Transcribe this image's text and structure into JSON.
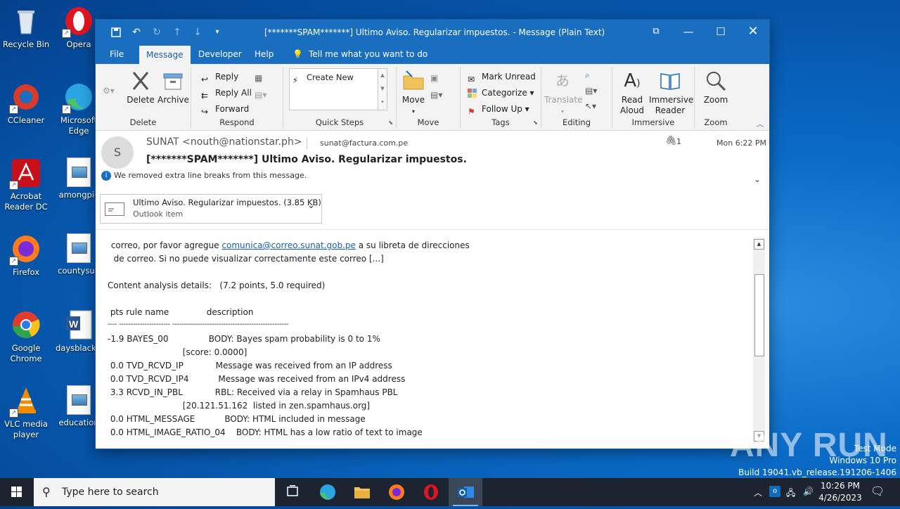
{
  "desktop": {
    "icons": [
      {
        "label": "Recycle Bin"
      },
      {
        "label": "Opera"
      },
      {
        "label": "CCleaner"
      },
      {
        "label": "Microsoft Edge"
      },
      {
        "label": "Acrobat Reader DC"
      },
      {
        "label": "amongpic"
      },
      {
        "label": "Firefox"
      },
      {
        "label": "countysub"
      },
      {
        "label": "Google Chrome"
      },
      {
        "label": "daysblack.r"
      },
      {
        "label": "VLC media player"
      },
      {
        "label": "education"
      }
    ]
  },
  "window": {
    "title": "[*******SPAM*******] Ultimo Aviso. Regularizar impuestos.  -  Message (Plain Text)",
    "menu": [
      "File",
      "Message",
      "Developer",
      "Help"
    ],
    "active_menu": "Message",
    "tell_me": "Tell me what you want to do"
  },
  "ribbon": {
    "delete_group": {
      "label": "Delete",
      "delete": "Delete",
      "archive": "Archive"
    },
    "respond_group": {
      "label": "Respond",
      "reply": "Reply",
      "reply_all": "Reply All",
      "forward": "Forward"
    },
    "quicksteps_group": {
      "label": "Quick Steps",
      "create_new": "Create New"
    },
    "move_group": {
      "label": "Move",
      "move": "Move"
    },
    "tags_group": {
      "label": "Tags",
      "mark_unread": "Mark Unread",
      "categorize": "Categorize",
      "follow_up": "Follow Up"
    },
    "editing_group": {
      "label": "Editing",
      "translate": "Translate"
    },
    "immersive_group": {
      "label": "Immersive",
      "read_aloud": "Read Aloud",
      "immersive_reader": "Immersive Reader"
    },
    "zoom_group": {
      "label": "Zoom",
      "zoom": "Zoom"
    }
  },
  "message": {
    "avatar_initial": "S",
    "sender": "SUNAT <nouth@nationstar.ph>",
    "recipient": "sunat@factura.com.pe",
    "attachment_count": "1",
    "date": "Mon 6:22 PM",
    "subject": "[*******SPAM*******] Ultimo Aviso. Regularizar impuestos.",
    "info": "We removed extra line breaks from this message.",
    "attachment": {
      "name": "Ultimo Aviso. Regularizar impuestos. (3.85 KB)",
      "type": "Outlook item"
    }
  },
  "body": {
    "line1_pre": " correo, por favor agregue ",
    "line1_link": "comunica@correo.sunat.gob.pe",
    "line1_post": " a su libreta de direcciones",
    "line2": "  de correo. Si no puede visualizar correctamente este correo [...]",
    "line3": "Content analysis details:   (7.2 points, 5.0 required)",
    "line4": " pts rule name              description",
    "line5": "---- ---------------------- --------------------------------------------------",
    "rows": [
      "-1.9 BAYES_00               BODY: Bayes spam probability is 0 to 1%",
      "                            [score: 0.0000]",
      " 0.0 TVD_RCVD_IP            Message was received from an IP address",
      " 0.0 TVD_RCVD_IP4           Message was received from an IPv4 address",
      " 3.3 RCVD_IN_PBL            RBL: Received via a relay in Spamhaus PBL",
      "                            [20.121.51.162  listed in zen.spamhaus.org]",
      " 0.0 HTML_MESSAGE           BODY: HTML included in message",
      " 0.0 HTML_IMAGE_RATIO_04    BODY: HTML has a low ratio of text to image"
    ]
  },
  "taskbar": {
    "search_placeholder": "Type here to search",
    "time": "10:26 PM",
    "date": "4/26/2023"
  },
  "watermark": {
    "brand": "ANY RUN",
    "line1": "Test Mode",
    "line2": "Windows 10 Pro",
    "line3": "Build 19041.vb_release.191206-1406"
  }
}
